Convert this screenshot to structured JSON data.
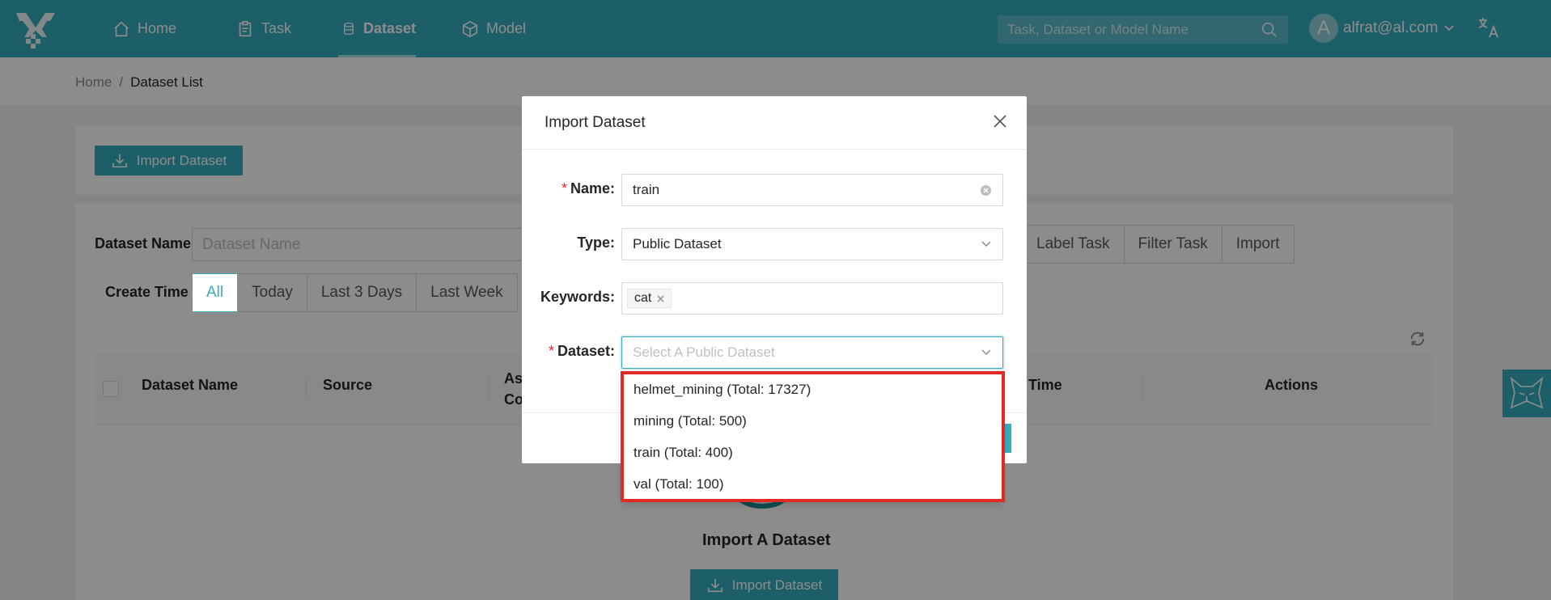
{
  "header": {
    "nav": [
      {
        "label": "Home",
        "icon": "home-icon"
      },
      {
        "label": "Task",
        "icon": "clipboard-icon"
      },
      {
        "label": "Dataset",
        "icon": "database-icon",
        "active": true
      },
      {
        "label": "Model",
        "icon": "cube-icon"
      }
    ],
    "search_placeholder": "Task, Dataset or Model Name",
    "user_initial": "A",
    "user_email": "alfrat@al.com"
  },
  "breadcrumb": {
    "home": "Home",
    "separator": "/",
    "current": "Dataset List"
  },
  "toolbar": {
    "import_label": "Import Dataset"
  },
  "filters": {
    "dataset_name_label": "Dataset Name",
    "dataset_name_placeholder": "Dataset Name",
    "source_options": [
      "Label Task",
      "Filter Task",
      "Import"
    ],
    "create_time_label": "Create Time",
    "time_options": [
      "All",
      "Today",
      "Last 3 Days",
      "Last Week"
    ],
    "time_selected": "All"
  },
  "table": {
    "columns": [
      "Dataset Name",
      "Source",
      "Ass",
      "Co",
      "Time",
      "Actions"
    ]
  },
  "empty": {
    "title": "Import A Dataset",
    "button": "Import Dataset"
  },
  "modal": {
    "title": "Import Dataset",
    "name_label": "Name",
    "name_value": "train",
    "type_label": "Type",
    "type_value": "Public Dataset",
    "keywords_label": "Keywords",
    "keywords": [
      "cat"
    ],
    "dataset_label": "Dataset",
    "dataset_placeholder": "Select A Public Dataset",
    "colon": ":",
    "required_mark": "*"
  },
  "dropdown": {
    "options": [
      "helmet_mining (Total: 17327)",
      "mining (Total: 500)",
      "train (Total: 400)",
      "val (Total: 100)"
    ]
  },
  "colors": {
    "brand": "#36aebd",
    "highlight": "#e12a24",
    "required": "#f5222d"
  }
}
